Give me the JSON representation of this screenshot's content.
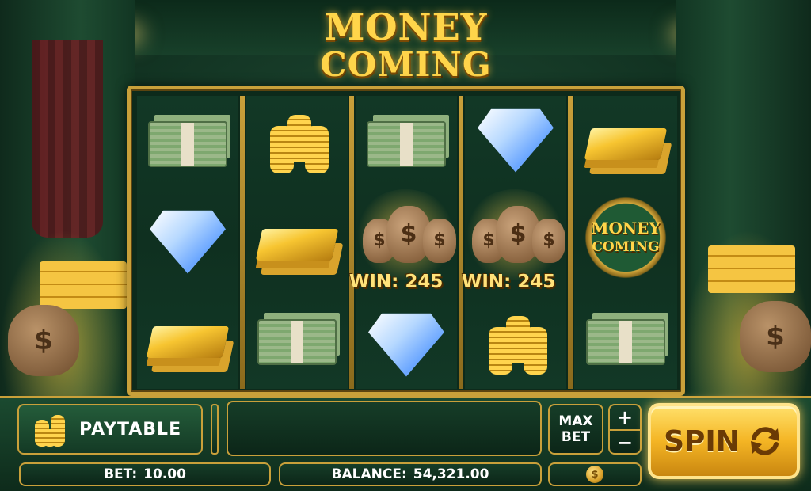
{
  "game": {
    "title_line1": "MONEY",
    "title_line2": "COMING"
  },
  "reels": {
    "symbols": [
      [
        "cash-stack",
        "diamond",
        "gold-bar"
      ],
      [
        "gold-coins",
        "gold-bar",
        "cash-stack"
      ],
      [
        "cash-stack",
        "money-bags",
        "diamond"
      ],
      [
        "diamond",
        "money-bags",
        "gold-coins"
      ],
      [
        "gold-bar",
        "money-coming-scatter",
        "cash-stack"
      ]
    ],
    "wins": [
      {
        "reel": 3,
        "row": 2,
        "label": "WIN: 245"
      },
      {
        "reel": 4,
        "row": 2,
        "label": "WIN: 245"
      }
    ],
    "scatter": {
      "line1": "MONEY",
      "line2": "COMING"
    }
  },
  "controls": {
    "paytable_label": "PAYTABLE",
    "maxbet_line1": "MAX",
    "maxbet_line2": "BET",
    "plus_label": "+",
    "minus_label": "−",
    "spin_label": "SPIN",
    "bet_label": "BET:",
    "bet_value": "10.00",
    "balance_label": "BALANCE:",
    "balance_value": "54,321.00",
    "coin_symbol": "$"
  },
  "colors": {
    "gold": "#c9a03a",
    "felt_green": "#123322",
    "win_text": "#ffe27a",
    "spin_button": "#f4b524"
  }
}
